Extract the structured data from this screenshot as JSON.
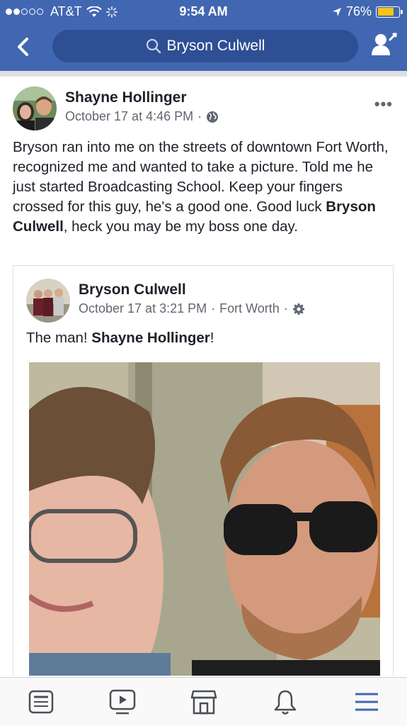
{
  "status_bar": {
    "carrier": "AT&T",
    "time": "9:54 AM",
    "battery_percent": "76%",
    "battery_level": 0.76
  },
  "header": {
    "search_text": "Bryson Culwell",
    "accent_color": "#4267b2"
  },
  "post": {
    "author": "Shayne Hollinger",
    "timestamp": "October 17 at 4:46 PM",
    "privacy_icon": "globe-icon",
    "body_parts": [
      "Bryson ran into me on the streets of downtown Fort Worth, recognized me and wanted to take a picture. Told me he just started Broadcasting School.  Keep your fingers crossed for this guy, he's a good one. Good luck ",
      "Bryson Culwell",
      ", heck you may be my boss one day."
    ],
    "shared": {
      "author": "Bryson Culwell",
      "timestamp": "October 17 at 3:21 PM",
      "location": "Fort Worth",
      "privacy_icon": "gear-icon",
      "text_prefix": "The man! ",
      "text_mention": "Shayne Hollinger",
      "text_suffix": "!"
    }
  },
  "bottom_nav": [
    {
      "name": "news-feed",
      "icon": "news-feed-icon"
    },
    {
      "name": "watch",
      "icon": "video-icon"
    },
    {
      "name": "marketplace",
      "icon": "marketplace-icon"
    },
    {
      "name": "notifications",
      "icon": "bell-icon"
    },
    {
      "name": "menu",
      "icon": "menu-icon"
    }
  ]
}
